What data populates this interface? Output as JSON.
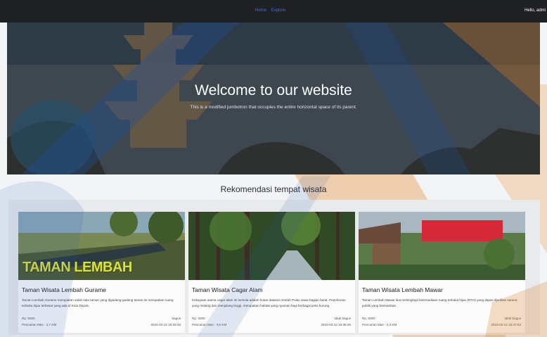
{
  "nav": {
    "links": [
      "Home",
      "Explore"
    ],
    "user": "Hello, admi"
  },
  "hero": {
    "title": "Welcome to our website",
    "subtitle": "This is a modified jumbotron that occupies the entire horizontal space of its parent."
  },
  "section": {
    "title": "Rekomendasi tempat wisata"
  },
  "cards": [
    {
      "title": "Taman Wisata Lembah Gurame",
      "image_text": "TAMAN LEMBAH",
      "description": "Taman Lembah Gurame merupakan salah satu taman yang digadang-gadang taman ini merupakan ruang terbuka hijau terbesar yang ada di Kota Depok.",
      "price": "Rp. 5000",
      "distance": "Pencarian Mas - 2,7 KM",
      "rating": "bagus",
      "date": "2023-03-12 18:29:49"
    },
    {
      "title": "Taman Wisata Cagar Alam",
      "image_text": "",
      "description": "Kekayaan utama cagar alam ini semula adalah hutan dataran rendah Pulau Jawa bagian barat. Pepohonan yang rindang dan menjulang tinggi, merupakan habitat yang nyaman bagi berbagai jenis burung.",
      "price": "Rp. 3000",
      "distance": "Pencarian Mas - 3,5 KM",
      "rating": "tidak bagus",
      "date": "2023-03-12 18:38:35"
    },
    {
      "title": "Taman Wisata Lembah Mawar",
      "image_text": "",
      "description": "Taman Lembah Mawar ikut melengkapi ketersediaan ruang terbuka hijau (RTH) yang dapat dijadikan sarana publik yang bermanfaat.",
      "price": "Rp. 5000",
      "distance": "Pencarian Mas - 2,3 KM",
      "rating": "tidak bagus",
      "date": "2023-03-12 18:47:53"
    }
  ],
  "colors": {
    "navbar": "#1f2125",
    "link": "#3b6fe0",
    "watermark_blue": "#1f55b5",
    "watermark_orange": "#d77a1f"
  }
}
